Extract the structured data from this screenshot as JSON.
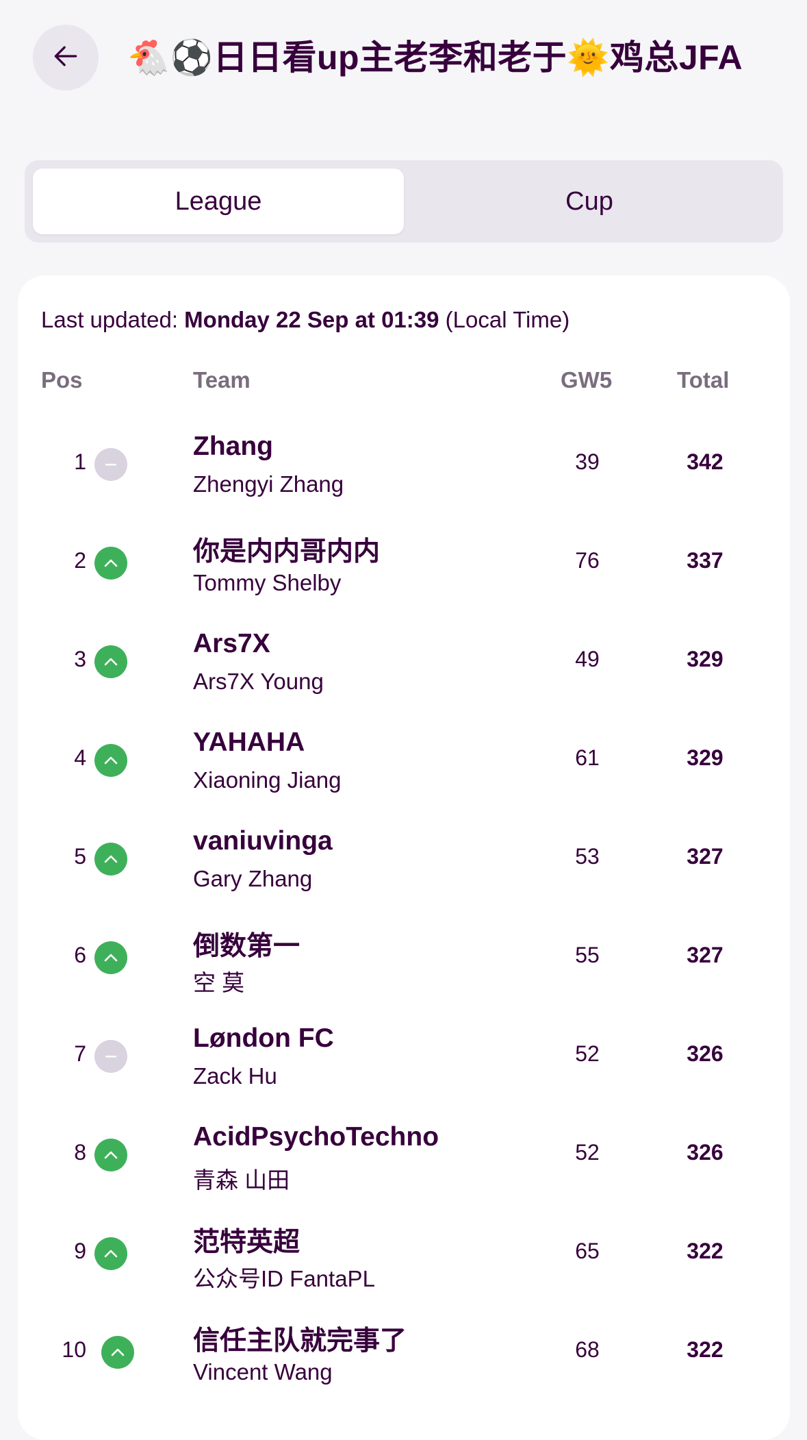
{
  "header": {
    "back_icon": "arrow-left-icon",
    "title": "🐔⚽日日看up主老李和老于🌞鸡总JFA"
  },
  "tabs": [
    {
      "label": "League",
      "active": true
    },
    {
      "label": "Cup",
      "active": false
    }
  ],
  "updated": {
    "prefix": "Last updated: ",
    "value": "Monday 22 Sep at 01:39",
    "suffix": " (Local Time)"
  },
  "columns": {
    "pos": "Pos",
    "team": "Team",
    "gw": "GW5",
    "total": "Total"
  },
  "colors": {
    "up": "#3fb05a",
    "same": "#d9d2df",
    "text": "#37003c"
  },
  "rows": [
    {
      "pos": "1",
      "move": "same",
      "team": "Zhang",
      "manager": "Zhengyi Zhang",
      "gw": "39",
      "total": "342"
    },
    {
      "pos": "2",
      "move": "up",
      "team": "你是内内哥内内",
      "manager": "Tommy Shelby",
      "gw": "76",
      "total": "337"
    },
    {
      "pos": "3",
      "move": "up",
      "team": "Ars7X",
      "manager": "Ars7X Young",
      "gw": "49",
      "total": "329"
    },
    {
      "pos": "4",
      "move": "up",
      "team": "YAHAHA",
      "manager": "Xiaoning Jiang",
      "gw": "61",
      "total": "329"
    },
    {
      "pos": "5",
      "move": "up",
      "team": "vaniuvinga",
      "manager": "Gary Zhang",
      "gw": "53",
      "total": "327"
    },
    {
      "pos": "6",
      "move": "up",
      "team": "倒数第一",
      "manager": "空 莫",
      "gw": "55",
      "total": "327"
    },
    {
      "pos": "7",
      "move": "same",
      "team": "Løndon FC",
      "manager": "Zack Hu",
      "gw": "52",
      "total": "326"
    },
    {
      "pos": "8",
      "move": "up",
      "team": "AcidPsychoTechno",
      "manager": "青森 山田",
      "gw": "52",
      "total": "326"
    },
    {
      "pos": "9",
      "move": "up",
      "team": "范特英超",
      "manager": "公众号ID FantaPL",
      "gw": "65",
      "total": "322"
    },
    {
      "pos": "10",
      "move": "up",
      "team": "信任主队就完事了",
      "manager": "Vincent Wang",
      "gw": "68",
      "total": "322"
    }
  ]
}
